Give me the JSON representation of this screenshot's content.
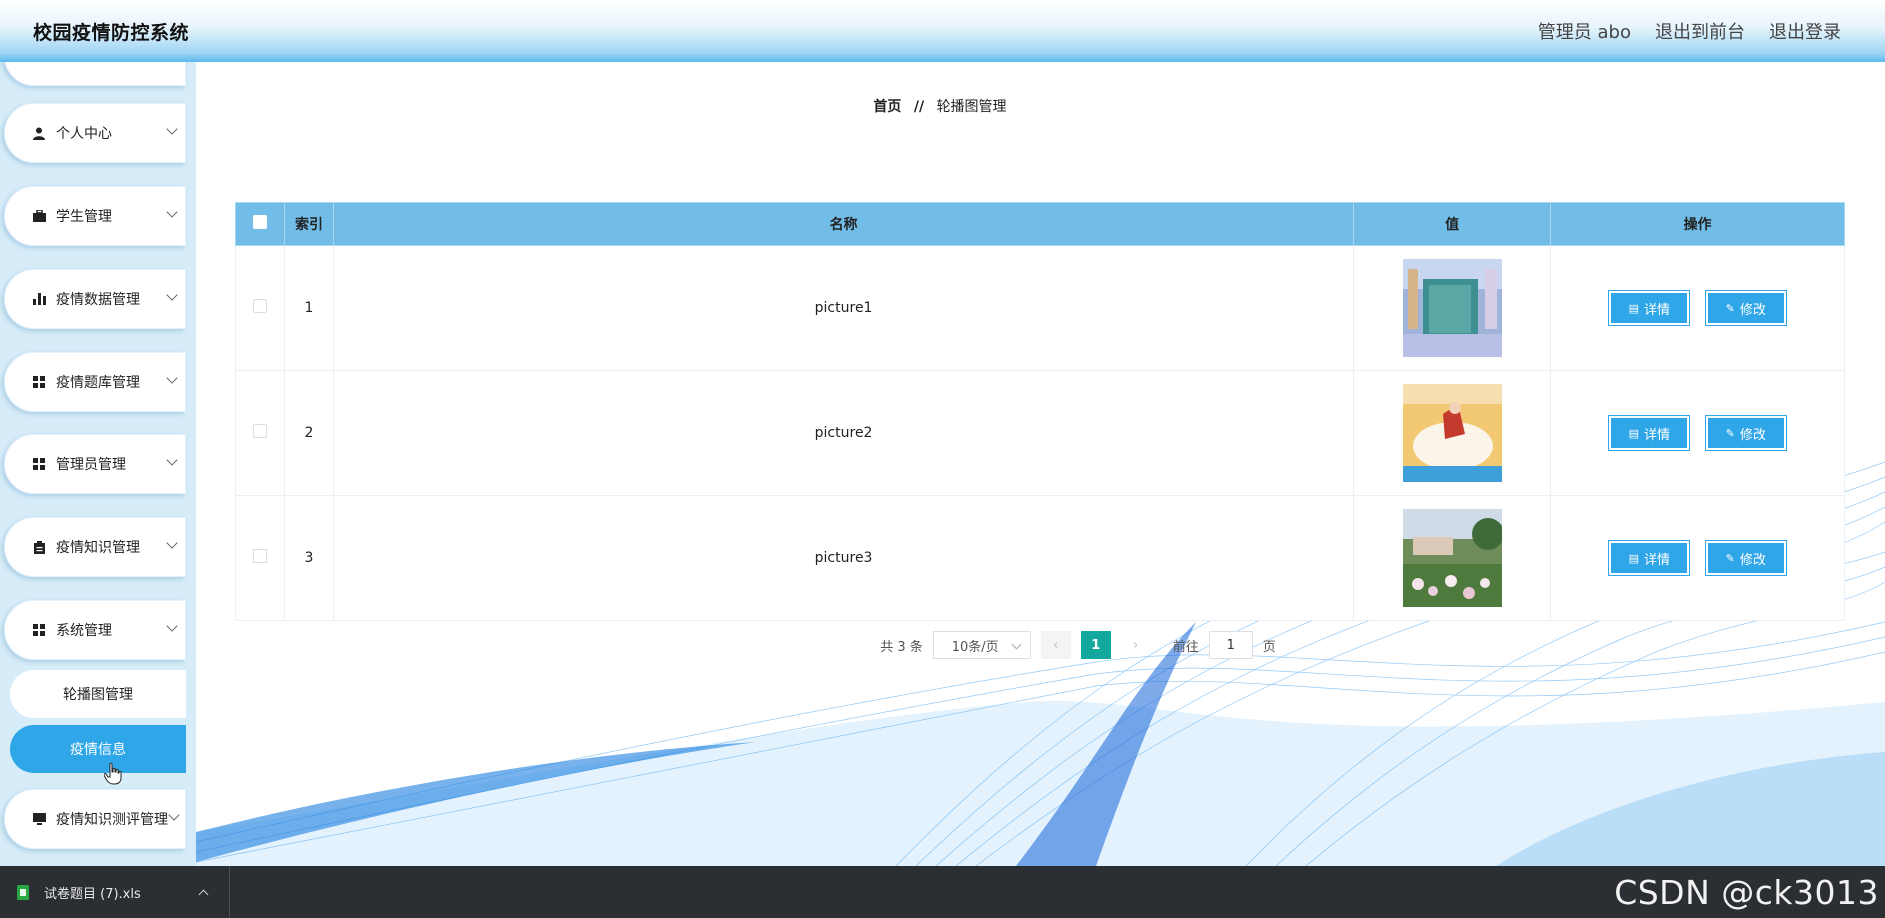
{
  "app": {
    "title": "校园疫情防控系统"
  },
  "header": {
    "links": [
      "管理员 abo",
      "退出到前台",
      "退出登录"
    ]
  },
  "sidebar": {
    "items": [
      {
        "label": "个人中心",
        "icon": "person-icon"
      },
      {
        "label": "学生管理",
        "icon": "briefcase-icon"
      },
      {
        "label": "疫情数据管理",
        "icon": "bar-chart-icon"
      },
      {
        "label": "疫情题库管理",
        "icon": "grid-icon"
      },
      {
        "label": "管理员管理",
        "icon": "grid-icon"
      },
      {
        "label": "疫情知识管理",
        "icon": "clipboard-icon"
      },
      {
        "label": "系统管理",
        "icon": "grid-icon"
      }
    ],
    "subitems": [
      {
        "label": "轮播图管理",
        "active": false
      },
      {
        "label": "疫情信息",
        "active": true
      }
    ],
    "last_item": {
      "label": "疫情知识测评管理",
      "icon": "monitor-icon"
    }
  },
  "breadcrumb": {
    "home": "首页",
    "separator": "//",
    "current": "轮播图管理"
  },
  "table": {
    "columns": [
      "索引",
      "名称",
      "值",
      "操作"
    ],
    "rows": [
      {
        "index": "1",
        "name": "picture1",
        "image": "classroom-photo"
      },
      {
        "index": "2",
        "name": "picture2",
        "image": "cartoon-photo"
      },
      {
        "index": "3",
        "name": "picture3",
        "image": "campus-flowers-photo"
      }
    ],
    "detail_label": "详情",
    "edit_label": "修改"
  },
  "pagination": {
    "total_text": "共 3 条",
    "page_size": "10条/页",
    "current_page": "1",
    "goto_prefix": "前往",
    "goto_value": "1",
    "goto_suffix": "页"
  },
  "download_bar": {
    "filename": "试卷题目 (7).xls"
  },
  "watermark": "CSDN @ck3013",
  "colors": {
    "accent": "#2fa6e8",
    "table_header": "#71bde8",
    "page_active": "#13a89e",
    "sidebar_bg": "#d6ecf8"
  }
}
